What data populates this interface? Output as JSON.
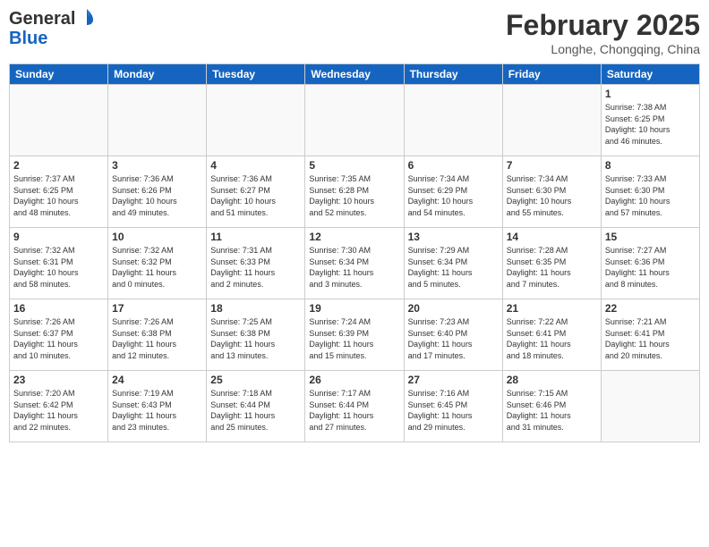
{
  "header": {
    "logo_general": "General",
    "logo_blue": "Blue",
    "month_title": "February 2025",
    "location": "Longhe, Chongqing, China"
  },
  "days_of_week": [
    "Sunday",
    "Monday",
    "Tuesday",
    "Wednesday",
    "Thursday",
    "Friday",
    "Saturday"
  ],
  "weeks": [
    [
      {
        "num": "",
        "info": "",
        "empty": true
      },
      {
        "num": "",
        "info": "",
        "empty": true
      },
      {
        "num": "",
        "info": "",
        "empty": true
      },
      {
        "num": "",
        "info": "",
        "empty": true
      },
      {
        "num": "",
        "info": "",
        "empty": true
      },
      {
        "num": "",
        "info": "",
        "empty": true
      },
      {
        "num": "1",
        "info": "Sunrise: 7:38 AM\nSunset: 6:25 PM\nDaylight: 10 hours\nand 46 minutes."
      }
    ],
    [
      {
        "num": "2",
        "info": "Sunrise: 7:37 AM\nSunset: 6:25 PM\nDaylight: 10 hours\nand 48 minutes."
      },
      {
        "num": "3",
        "info": "Sunrise: 7:36 AM\nSunset: 6:26 PM\nDaylight: 10 hours\nand 49 minutes."
      },
      {
        "num": "4",
        "info": "Sunrise: 7:36 AM\nSunset: 6:27 PM\nDaylight: 10 hours\nand 51 minutes."
      },
      {
        "num": "5",
        "info": "Sunrise: 7:35 AM\nSunset: 6:28 PM\nDaylight: 10 hours\nand 52 minutes."
      },
      {
        "num": "6",
        "info": "Sunrise: 7:34 AM\nSunset: 6:29 PM\nDaylight: 10 hours\nand 54 minutes."
      },
      {
        "num": "7",
        "info": "Sunrise: 7:34 AM\nSunset: 6:30 PM\nDaylight: 10 hours\nand 55 minutes."
      },
      {
        "num": "8",
        "info": "Sunrise: 7:33 AM\nSunset: 6:30 PM\nDaylight: 10 hours\nand 57 minutes."
      }
    ],
    [
      {
        "num": "9",
        "info": "Sunrise: 7:32 AM\nSunset: 6:31 PM\nDaylight: 10 hours\nand 58 minutes."
      },
      {
        "num": "10",
        "info": "Sunrise: 7:32 AM\nSunset: 6:32 PM\nDaylight: 11 hours\nand 0 minutes."
      },
      {
        "num": "11",
        "info": "Sunrise: 7:31 AM\nSunset: 6:33 PM\nDaylight: 11 hours\nand 2 minutes."
      },
      {
        "num": "12",
        "info": "Sunrise: 7:30 AM\nSunset: 6:34 PM\nDaylight: 11 hours\nand 3 minutes."
      },
      {
        "num": "13",
        "info": "Sunrise: 7:29 AM\nSunset: 6:34 PM\nDaylight: 11 hours\nand 5 minutes."
      },
      {
        "num": "14",
        "info": "Sunrise: 7:28 AM\nSunset: 6:35 PM\nDaylight: 11 hours\nand 7 minutes."
      },
      {
        "num": "15",
        "info": "Sunrise: 7:27 AM\nSunset: 6:36 PM\nDaylight: 11 hours\nand 8 minutes."
      }
    ],
    [
      {
        "num": "16",
        "info": "Sunrise: 7:26 AM\nSunset: 6:37 PM\nDaylight: 11 hours\nand 10 minutes."
      },
      {
        "num": "17",
        "info": "Sunrise: 7:26 AM\nSunset: 6:38 PM\nDaylight: 11 hours\nand 12 minutes."
      },
      {
        "num": "18",
        "info": "Sunrise: 7:25 AM\nSunset: 6:38 PM\nDaylight: 11 hours\nand 13 minutes."
      },
      {
        "num": "19",
        "info": "Sunrise: 7:24 AM\nSunset: 6:39 PM\nDaylight: 11 hours\nand 15 minutes."
      },
      {
        "num": "20",
        "info": "Sunrise: 7:23 AM\nSunset: 6:40 PM\nDaylight: 11 hours\nand 17 minutes."
      },
      {
        "num": "21",
        "info": "Sunrise: 7:22 AM\nSunset: 6:41 PM\nDaylight: 11 hours\nand 18 minutes."
      },
      {
        "num": "22",
        "info": "Sunrise: 7:21 AM\nSunset: 6:41 PM\nDaylight: 11 hours\nand 20 minutes."
      }
    ],
    [
      {
        "num": "23",
        "info": "Sunrise: 7:20 AM\nSunset: 6:42 PM\nDaylight: 11 hours\nand 22 minutes."
      },
      {
        "num": "24",
        "info": "Sunrise: 7:19 AM\nSunset: 6:43 PM\nDaylight: 11 hours\nand 23 minutes."
      },
      {
        "num": "25",
        "info": "Sunrise: 7:18 AM\nSunset: 6:44 PM\nDaylight: 11 hours\nand 25 minutes."
      },
      {
        "num": "26",
        "info": "Sunrise: 7:17 AM\nSunset: 6:44 PM\nDaylight: 11 hours\nand 27 minutes."
      },
      {
        "num": "27",
        "info": "Sunrise: 7:16 AM\nSunset: 6:45 PM\nDaylight: 11 hours\nand 29 minutes."
      },
      {
        "num": "28",
        "info": "Sunrise: 7:15 AM\nSunset: 6:46 PM\nDaylight: 11 hours\nand 31 minutes."
      },
      {
        "num": "",
        "info": "",
        "empty": true
      }
    ]
  ]
}
